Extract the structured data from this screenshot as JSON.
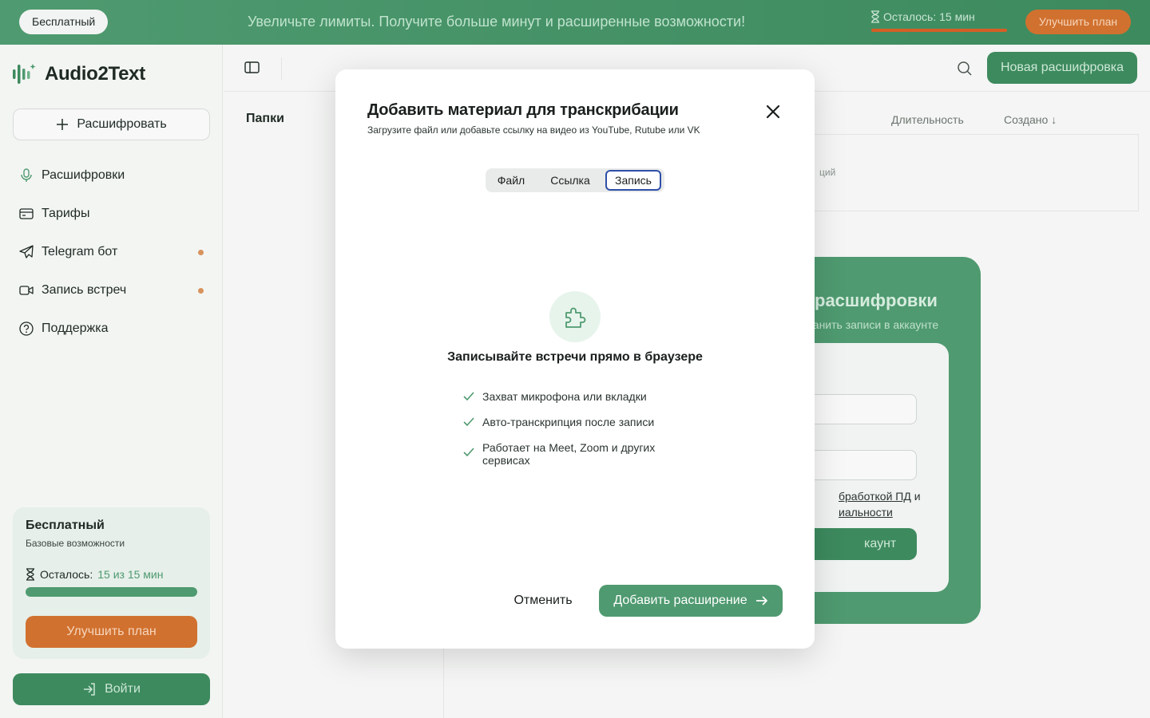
{
  "banner": {
    "plan_label": "Бесплатный",
    "promo_text": "Увеличьте лимиты. Получите больше минут и расширенные возможности!",
    "remaining_text": "Осталось: 15 мин",
    "upgrade_label": "Улучшить план"
  },
  "sidebar": {
    "brand": "Audio2Text",
    "decode_label": "Расшифровать",
    "items": [
      {
        "label": "Расшифровки",
        "icon": "mic-icon"
      },
      {
        "label": "Тарифы",
        "icon": "card-icon"
      },
      {
        "label": "Telegram бот",
        "icon": "telegram-icon"
      },
      {
        "label": "Запись встреч",
        "icon": "video-icon"
      },
      {
        "label": "Поддержка",
        "icon": "help-icon"
      }
    ],
    "plan": {
      "name": "Бесплатный",
      "desc": "Базовые возможности",
      "remaining_label": "Осталось:",
      "remaining_value": "15 из 15 мин",
      "progress": 1.0,
      "upgrade_label": "Улучшить план"
    },
    "login_label": "Войти"
  },
  "main": {
    "new_label": "Новая расшифровка",
    "folders_label": "Папки",
    "columns": {
      "duration": "Длительность",
      "created": "Создано ↓"
    },
    "row_muted": "ций",
    "bg_card": {
      "heading": "расшифровки",
      "sub": "ранить записи в аккаунте",
      "consent_line1": "бработкой ПД",
      "consent_and": " и",
      "consent_line2": "иальности",
      "account_btn": "каунт"
    }
  },
  "modal": {
    "title": "Добавить материал для транскрибации",
    "subtitle": "Загрузите файл или добавьте ссылку на видео из YouTube, Rutube или VK",
    "tabs": [
      "Файл",
      "Ссылка",
      "Запись"
    ],
    "active_tab": "Запись",
    "ext_title": "Записывайте встречи прямо в браузере",
    "features": [
      "Захват микрофона или вкладки",
      "Авто-транскрипция после записи",
      "Работает на Meet, Zoom и других сервисах"
    ],
    "cancel_label": "Отменить",
    "add_label": "Добавить расширение"
  },
  "colors": {
    "accent": "#4f9a70",
    "accent_dark": "#3d8a5e",
    "orange": "#d1712f",
    "active_tab_border": "#2f4fa8"
  }
}
